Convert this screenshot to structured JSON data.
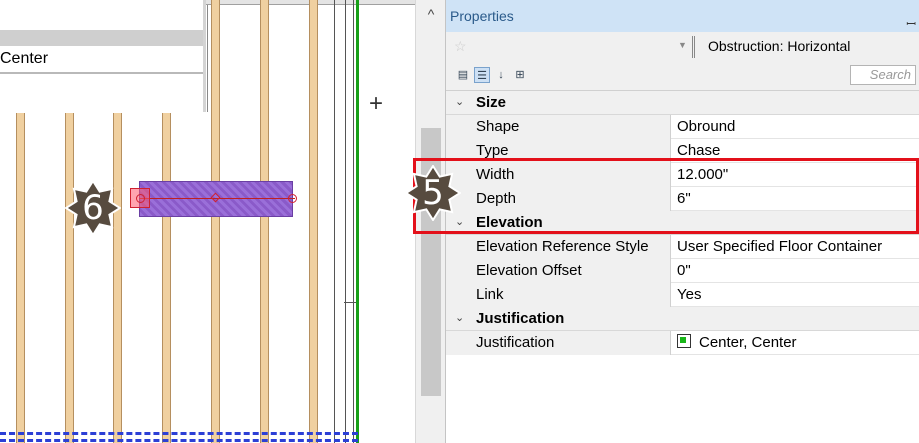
{
  "canvas": {
    "center_label": "Center",
    "element_color": "#9a6fd9",
    "grid_line_color": "#18a018"
  },
  "callouts": [
    {
      "number": "6"
    },
    {
      "number": "5"
    }
  ],
  "properties": {
    "title": "Properties",
    "type_selector": "Obstruction: Horizontal",
    "search_placeholder": "Search",
    "groups": [
      {
        "label": "Size",
        "rows": [
          {
            "name": "Shape",
            "value": "Obround"
          },
          {
            "name": "Type",
            "value": "Chase"
          },
          {
            "name": "Width",
            "value": "12.000\""
          },
          {
            "name": "Depth",
            "value": "6\""
          }
        ]
      },
      {
        "label": "Elevation",
        "rows": [
          {
            "name": "Elevation Reference Style",
            "value": "User Specified Floor Container"
          },
          {
            "name": "Elevation Offset",
            "value": "0\""
          },
          {
            "name": "Link",
            "value": "Yes"
          }
        ]
      },
      {
        "label": "Justification",
        "rows": [
          {
            "name": "Justification",
            "value": "Center, Center",
            "icon": "justification-center-icon"
          }
        ]
      }
    ]
  },
  "highlight_color": "#e3101a"
}
